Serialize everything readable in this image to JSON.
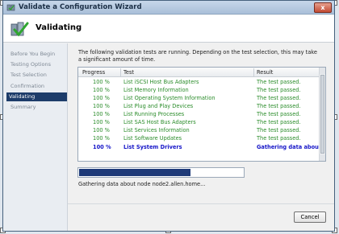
{
  "window": {
    "title": "Validate a Configuration Wizard",
    "close_glyph": "x"
  },
  "header": {
    "title": "Validating",
    "icon": "cluster-validate-icon"
  },
  "nav": {
    "items": [
      {
        "label": "Before You Begin",
        "active": false
      },
      {
        "label": "Testing Options",
        "active": false
      },
      {
        "label": "Test Selection",
        "active": false
      },
      {
        "label": "Confirmation",
        "active": false
      },
      {
        "label": "Validating",
        "active": true
      },
      {
        "label": "Summary",
        "active": false
      }
    ]
  },
  "description": "The following validation tests are running. Depending on the test selection, this may take a significant amount of time.",
  "grid": {
    "columns": [
      "Progress",
      "Test",
      "Result"
    ],
    "rows": [
      {
        "progress": "100 %",
        "test": "List iSCSI Host Bus Adapters",
        "result": "The test passed."
      },
      {
        "progress": "100 %",
        "test": "List Memory Information",
        "result": "The test passed."
      },
      {
        "progress": "100 %",
        "test": "List Operating System Information",
        "result": "The test passed."
      },
      {
        "progress": "100 %",
        "test": "List Plug and Play Devices",
        "result": "The test passed."
      },
      {
        "progress": "100 %",
        "test": "List Running Processes",
        "result": "The test passed."
      },
      {
        "progress": "100 %",
        "test": "List SAS Host Bus Adapters",
        "result": "The test passed."
      },
      {
        "progress": "100 %",
        "test": "List Services Information",
        "result": "The test passed."
      },
      {
        "progress": "100 %",
        "test": "List Software Updates",
        "result": "The test passed."
      },
      {
        "progress": "100 %",
        "test": "List System Drivers",
        "result": "Gathering data about n",
        "current": true
      }
    ]
  },
  "progress": {
    "fraction": 0.68
  },
  "status_text": "Gathering data about node node2.allen.home...",
  "buttons": {
    "cancel": "Cancel"
  },
  "colors": {
    "passed": "#2a8c2a",
    "running": "#1515c8",
    "selection": "#1d3c6a",
    "progress_fill": "#1e3a78"
  }
}
